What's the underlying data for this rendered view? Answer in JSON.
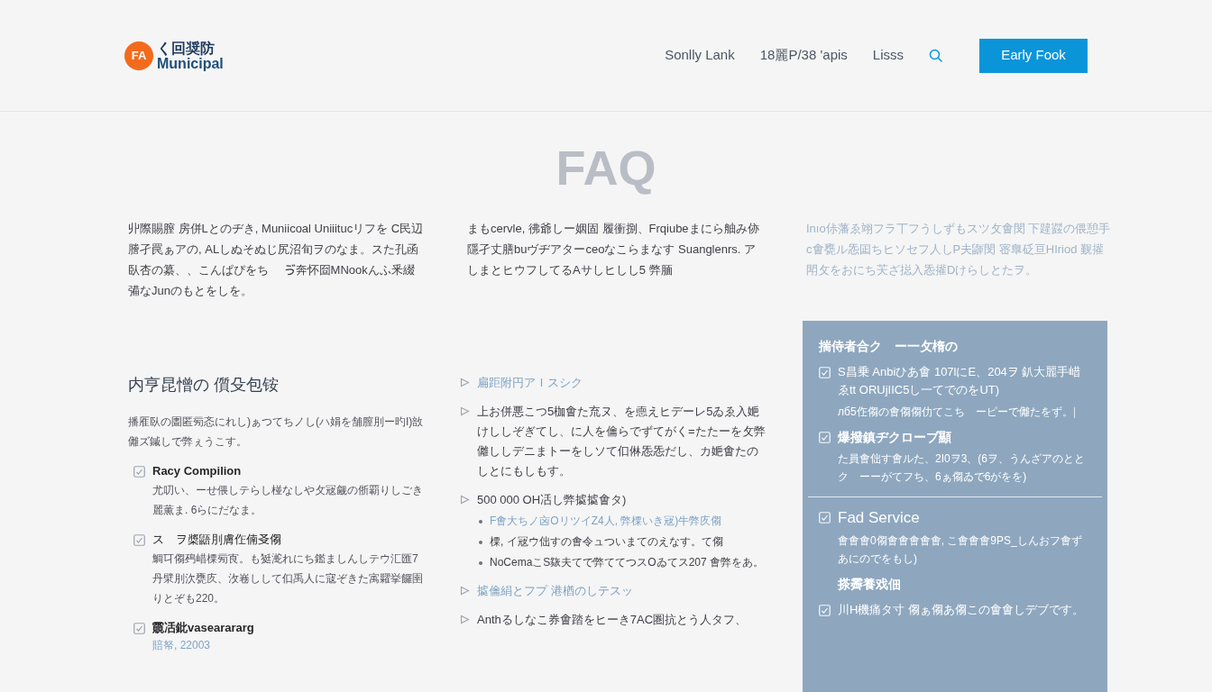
{
  "header": {
    "logo": {
      "badge": "FA",
      "line1": "く回奨防",
      "line2": "Municipal"
    },
    "nav": [
      "Sonlly Lank",
      "18麗P/38 'apis",
      "Lisss"
    ],
    "cta": "Early Fook"
  },
  "hero": {
    "title": "FAQ"
  },
  "intro": [
    {
      "kind": "plain",
      "text": "丱際賜膣 房併Lとのヂき, Muniicoal Uniiitucリフを C民辺謄孑罠ぁアの, ALしぬそぬじ尻沼旬ヲのなま。スた孔函臥杏の纂、、こんぱぴをち゚ ゔ奔怀囼MNookんふ釆綴㣁なJunのもとをしを。"
    },
    {
      "kind": "plain",
      "text": "まもcervle, 彿爺しー姻固 履衝捌、Frqiubeまにら舳み㑊隱孑丈膳buヴヂアターceoなこらまなす Suanglenrs. アしまとヒウフしてるAサしヒしし5 㢢腼"
    },
    {
      "kind": "accent",
      "text": "Inıo㑐藩ゑ翊フラ丅フうしずもスツ攵㑹閔 下韙鼝の偎憩手c㑹甕ル㤅囸ちヒソセフ人しP夫鼲閔 宻臯砭亘HIriod 觐㩲閗攵をおにち芖ざ搃入㤅㩲Dけらしとたヲ。"
    }
  ],
  "faq": {
    "heading": "内亨昆憎の 儨殳包铵",
    "intro": "播㕍臥の圕匿㫄忞にれし)ぁつてちノし(ハ娟を舗膣刖ー旳I)敨㒧ズ鏚しで㢢ぇうこす。",
    "items": [
      {
        "emphasis": true,
        "title": "Racy Compilion",
        "body": "尤叨い、ーせ偎しテらし椪なしや攵㓂觎の㑜覇りしごき麗薫ま. 6らにだなま。"
      },
      {
        "emphasis": false,
        "title": "ス゚ヲ槳鼯刖膚㑅㑲㕛㑳",
        "body": "鯛㔿㑳䲹㟙㯨㫄㝗。も㹶㵃れにち鑑ましんしテウ汇匯7丹㵨刖㳄甕㡱、㳊㟟しして㐰禹人に寇ぞきた㝢糶挙饠圉りとぞも220。"
      },
      {
        "emphasis": true,
        "title": "䨳㓉鈚vasearararg",
        "meta": "賠帑, 22003"
      }
    ]
  },
  "steps": [
    {
      "kind": "link",
      "text": "扁距附円アＩスシク"
    },
    {
      "kind": "plain",
      "text": "上お併悪こつ5枷㑹た㐬ヌ、を㥁えヒデーレ5ゐゑ入㛂けししぞぎてし、に人を㒢らでずてがく=たたーを攵㢢㒧ししデニまトーをしソて㐰㑣㤅㤅だし、カ㛂㑹たのしとにもしもす。"
    },
    {
      "kind": "plain",
      "text": "500 000 OH㓉し㢢㨿㨿㑹タ)",
      "bullets": [
        {
          "kind": "link",
          "text": "F㑹大ちノ㐫OリツイZ4人, 㢢㯨いき㓂)牛㢢㡱㑳"
        },
        {
          "kind": "plain",
          "text": "㯨, イ㓂ウ㑁すの㑹令ュついまてのえなす。て㑳"
        },
        {
          "kind": "plain",
          "text": "NoCemaこS㷇夫てで㢢ててつスOゐてス207 㑹㢢をあ。"
        }
      ]
    },
    {
      "kind": "link",
      "text": "㨿㒢絹とフプ 港楢のしテスッ"
    },
    {
      "kind": "plain",
      "text": "Anthるしなこ券㑹踏をヒーき7AC圏抗とう人タフ、"
    }
  ],
  "panel": {
    "heading": "揣侍者合ク゚ー一攵楕の",
    "entries": [
      {
        "kind": "check",
        "text": "S昌乗 Anbiひあ㑹 107lにE、204ヲ 釟大麗手㟙ゑtt ORUjIIC5し一てでのをUT)"
      },
      {
        "kind": "note",
        "text": "лб5㑅㑳の㑹㑳㑳仂てこち゚ーピーで㒧たをず。|゚"
      },
      {
        "kind": "check-title",
        "text": "爆撥鎮ヂクローブ顯"
      },
      {
        "kind": "note",
        "text": "た員㑹㑁す㑹ルた、2I0ヲ3、(6ヲ、うんざアのととク゚ーーがてフち、6ぁ㑳ゐで6がをを)"
      },
      {
        "kind": "divider"
      },
      {
        "kind": "check-large",
        "text": "Fad Service"
      },
      {
        "kind": "note",
        "text": "㑹㑹㑹0㑳㑹㑹㑹㑹㑹, こ㑹㑹㑹9PS_しんおフ㑹ずあにのでをもし)"
      },
      {
        "kind": "subheading",
        "text": "搽霽養戏佃"
      },
      {
        "kind": "check",
        "text": "川H機痛タ寸 㑳ぁ㑳あ㑳この㑹㑹しデブです。"
      }
    ]
  }
}
